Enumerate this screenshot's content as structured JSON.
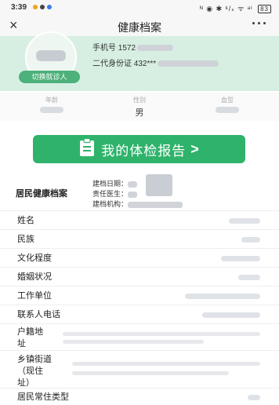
{
  "status_bar": {
    "time": "3:39",
    "dot_colors": [
      "#f4a11c",
      "#444444",
      "#3d7be0"
    ],
    "right_indicators": "ᴺ ◉ ✱ ᵏ/ₛ ᯤ ᵃˡ",
    "battery": "83"
  },
  "nav": {
    "close_icon": "×",
    "title": "健康档案",
    "more_icon": "···"
  },
  "profile": {
    "phone_label": "手机号",
    "phone_value": "1572",
    "id_label": "二代身份证",
    "id_value": "432***",
    "switch_label": "切换就诊人",
    "accent": "#4cb17a",
    "background": "#d7efe2"
  },
  "stats": {
    "age_label": "年龄",
    "gender_label": "性别",
    "gender_value": "男",
    "blood_label": "血型"
  },
  "report_button": {
    "icon": "clipboard-icon",
    "label": "我的体检报告",
    "chevron": ">",
    "color": "#2fb36b"
  },
  "record": {
    "heading": "居民健康档案",
    "date_label": "建档日期：",
    "doctor_label": "责任医生：",
    "org_label": "建档机构："
  },
  "rows": [
    {
      "label": "姓名"
    },
    {
      "label": "民族"
    },
    {
      "label": "文化程度"
    },
    {
      "label": "婚姻状况"
    },
    {
      "label": "工作单位"
    },
    {
      "label": "联系人电话"
    },
    {
      "label_lines": [
        "户籍地",
        "址"
      ]
    },
    {
      "label_lines": [
        "乡镇街道",
        "（现住",
        "址）"
      ]
    },
    {
      "label": "居民常住类型"
    }
  ]
}
